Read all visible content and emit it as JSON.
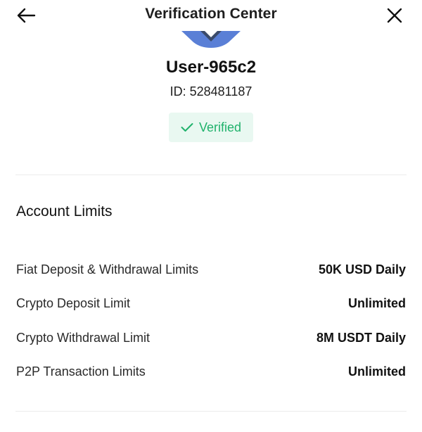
{
  "header": {
    "title": "Verification Center",
    "back_icon": "arrow-left-icon",
    "close_icon": "close-icon"
  },
  "profile": {
    "username": "User-965c2",
    "id_text": "ID: 528481187",
    "status": "Verified",
    "status_icon": "check-icon",
    "status_color": "#20b26c"
  },
  "account_limits": {
    "title": "Account Limits",
    "rows": [
      {
        "label": "Fiat Deposit & Withdrawal Limits",
        "value": "50K USD Daily"
      },
      {
        "label": "Crypto Deposit Limit",
        "value": "Unlimited"
      },
      {
        "label": "Crypto Withdrawal Limit",
        "value": "8M USDT Daily"
      },
      {
        "label": "P2P Transaction Limits",
        "value": "Unlimited"
      }
    ]
  }
}
